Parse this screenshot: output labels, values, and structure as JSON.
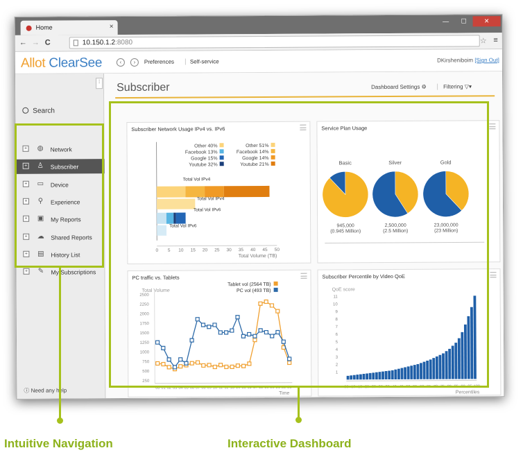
{
  "browser": {
    "tab_title": "Home",
    "url_host": "10.150.1.2",
    "url_port": ":8080"
  },
  "app": {
    "logo_brand": "Allot",
    "logo_product": "ClearSee",
    "header_links": [
      "Preferences",
      "Self-service"
    ],
    "user_name": "DKirsheniboim",
    "sign_out": "[Sign Out]"
  },
  "sidebar": {
    "search_label": "Search",
    "items": [
      {
        "label": "Network",
        "icon": "globe-icon"
      },
      {
        "label": "Subscriber",
        "icon": "person-icon",
        "active": true
      },
      {
        "label": "Device",
        "icon": "monitor-icon"
      },
      {
        "label": "Experience",
        "icon": "location-pin-icon"
      },
      {
        "label": "My Reports",
        "icon": "inbox-icon"
      },
      {
        "label": "Shared Reports",
        "icon": "cloud-icon"
      },
      {
        "label": "History List",
        "icon": "list-icon"
      },
      {
        "label": "My Subscriptions",
        "icon": "edit-icon"
      }
    ],
    "help_label": "Need any help"
  },
  "main": {
    "page_title": "Subscriber",
    "dashboard_settings": "Dashboard Settings",
    "filtering": "Filtering"
  },
  "panels": {
    "ipv4_ipv6": {
      "title": "Subscriber Network Usage IPv4 vs. IPv6",
      "legend_left": [
        "Other 40%",
        "Facebook 13%",
        "Google 15%",
        "Youtube 32%"
      ],
      "legend_right": [
        "Other 51%",
        "Facebook 14%",
        "Google 14%",
        "Youtube 21%"
      ],
      "bar_labels": [
        "Total Vol IPv4",
        "Total Vol IPv4",
        "Total Vol IPv6",
        "Total Vol IPv6"
      ],
      "xticks": [
        "0",
        "5",
        "10",
        "15",
        "20",
        "25",
        "30",
        "35",
        "40",
        "45",
        "50"
      ],
      "xlabel": "Total Volume (TB)"
    },
    "service_plan": {
      "title": "Service Plan Usage",
      "plans": [
        {
          "name": "Basic",
          "value": "945,000",
          "sub": "(0.945 Million)"
        },
        {
          "name": "Silver",
          "value": "2,500,000",
          "sub": "(2.5 Million)"
        },
        {
          "name": "Gold",
          "value": "23,000,000",
          "sub": "(23 Million)"
        }
      ]
    },
    "pc_tablets": {
      "title": "PC traffic vs. Tablets",
      "ylabel": "Total Volume",
      "legend": [
        "Tablet vol (2564 TB)",
        "PC vol (493 TB)"
      ],
      "xlabel": "Time"
    },
    "video_qoe": {
      "title": "Subscriber Percentile by Video QoE",
      "ylabel": "QoE score",
      "xlabel": "Percentiles"
    }
  },
  "annotations": {
    "left": "Intuitive Navigation",
    "right": "Interactive Dashboard"
  },
  "chart_data": [
    {
      "type": "bar",
      "title": "Subscriber Network Usage IPv4 vs. IPv6",
      "orientation": "horizontal",
      "xlabel": "Total Volume (TB)",
      "xlim": [
        0,
        50
      ],
      "series": [
        {
          "name": "Total Vol IPv4",
          "segments": [
            {
              "name": "Other",
              "value": 12
            },
            {
              "name": "Facebook",
              "value": 8
            },
            {
              "name": "Google",
              "value": 8
            },
            {
              "name": "Youtube",
              "value": 19
            }
          ]
        },
        {
          "name": "Total Vol IPv4",
          "segments": [
            {
              "name": "Other",
              "value": 16
            }
          ]
        },
        {
          "name": "Total Vol IPv6",
          "segments": [
            {
              "name": "Other",
              "value": 4
            },
            {
              "name": "Facebook",
              "value": 3
            },
            {
              "name": "Google",
              "value": 1
            },
            {
              "name": "Youtube",
              "value": 4
            }
          ]
        },
        {
          "name": "Total Vol IPv6",
          "segments": [
            {
              "name": "Other",
              "value": 4
            }
          ]
        }
      ],
      "colors": {
        "Other": "#fcd47a",
        "Facebook": "#f5b640",
        "Google": "#f09a25",
        "Youtube": "#e07e10",
        "Other6": "#c7e3f2",
        "Facebook6": "#58b5e3",
        "Google6": "#1b3f7a",
        "Youtube6": "#2366b5"
      }
    },
    {
      "type": "pie",
      "title": "Service Plan Usage",
      "categories": [
        "Basic",
        "Silver",
        "Gold"
      ],
      "series": [
        {
          "name": "Basic",
          "values": [
            88,
            12
          ]
        },
        {
          "name": "Silver",
          "values": [
            41,
            59
          ]
        },
        {
          "name": "Gold",
          "values": [
            38,
            62
          ]
        }
      ],
      "colors": [
        "#f5b425",
        "#1f5fa8"
      ]
    },
    {
      "type": "line",
      "title": "PC traffic vs. Tablets",
      "ylabel": "Total Volume",
      "xlabel": "Time",
      "yticks": [
        "250",
        "500",
        "750",
        "1000",
        "1250",
        "1500",
        "1750",
        "2000",
        "2250",
        "2500"
      ],
      "xticks": [
        "00",
        "01",
        "02",
        "03",
        "04",
        "05",
        "06",
        "07",
        "08",
        "09",
        "10",
        "11",
        "12",
        "13",
        "14",
        "15",
        "16",
        "17",
        "18",
        "19",
        "20",
        "21",
        "22",
        "23"
      ],
      "ylim": [
        250,
        2500
      ],
      "series": [
        {
          "name": "Tablet vol (2564 TB)",
          "color": "#f0a030",
          "values": [
            700,
            680,
            600,
            550,
            620,
            650,
            700,
            720,
            640,
            650,
            600,
            650,
            600,
            600,
            630,
            620,
            680,
            1300,
            2250,
            2300,
            2200,
            2050,
            1100,
            700
          ]
        },
        {
          "name": "PC vol (493 TB)",
          "color": "#2d6aa8",
          "values": [
            1250,
            1100,
            800,
            600,
            800,
            700,
            1300,
            1850,
            1700,
            1650,
            1700,
            1500,
            1500,
            1550,
            1900,
            1400,
            1450,
            1400,
            1550,
            1500,
            1400,
            1500,
            1250,
            800
          ]
        }
      ]
    },
    {
      "type": "bar",
      "title": "Subscriber Percentile by Video QoE",
      "ylabel": "QoE score",
      "xlabel": "Percentiles",
      "ylim": [
        0,
        11
      ],
      "yticks": [
        "1",
        "2",
        "3",
        "4",
        "5",
        "6",
        "7",
        "8",
        "9",
        "10",
        "11"
      ],
      "xticks": [
        "00",
        "10",
        "15",
        "20",
        "25",
        "30",
        "35",
        "40",
        "45",
        "50",
        "55",
        "60",
        "65",
        "70",
        "75",
        "80",
        "85",
        "90",
        "95",
        "100"
      ],
      "values": [
        0.5,
        0.55,
        0.6,
        0.65,
        0.7,
        0.75,
        0.8,
        0.85,
        0.9,
        0.95,
        1.0,
        1.05,
        1.1,
        1.15,
        1.2,
        1.3,
        1.4,
        1.5,
        1.6,
        1.7,
        1.8,
        1.9,
        2.0,
        2.15,
        2.3,
        2.45,
        2.6,
        2.8,
        3.0,
        3.2,
        3.4,
        3.7,
        4.0,
        4.4,
        4.8,
        5.4,
        6.2,
        7.2,
        8.3,
        9.5,
        11.0
      ],
      "color": "#1f5fa8"
    }
  ]
}
